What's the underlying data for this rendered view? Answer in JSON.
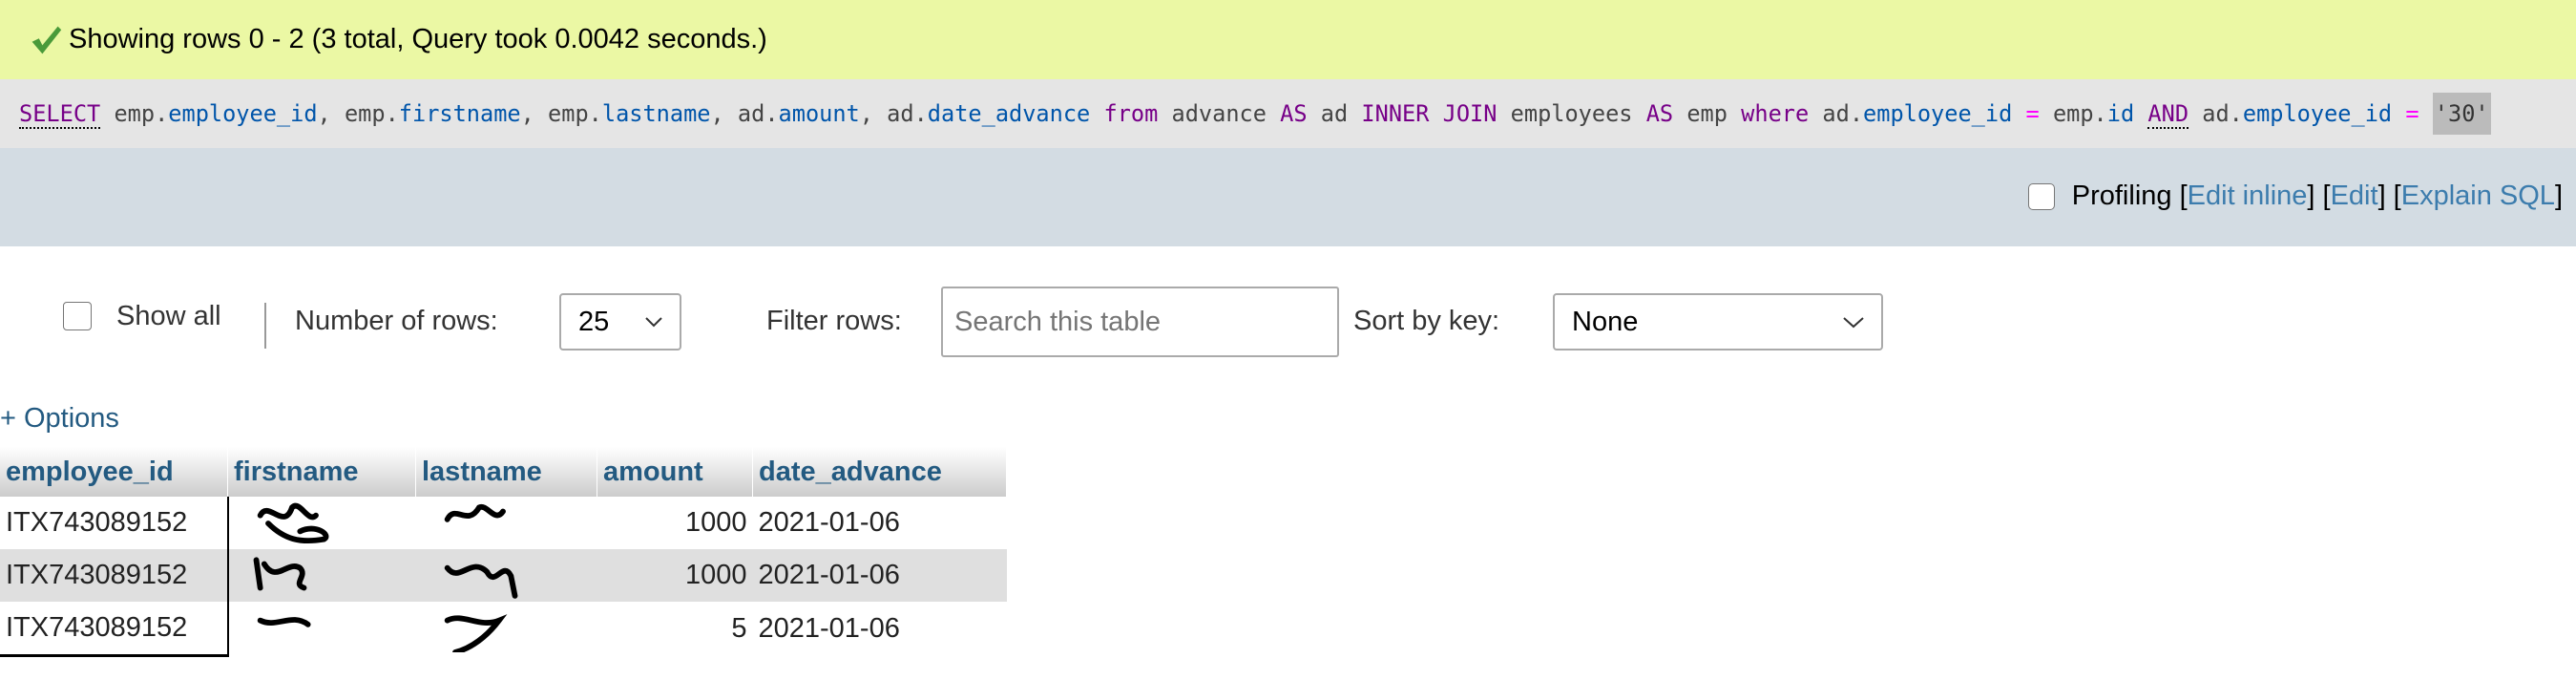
{
  "status": {
    "icon": "check-icon",
    "message": "Showing rows 0 - 2 (3 total, Query took 0.0042 seconds.)",
    "color": "#ebf8a4"
  },
  "sql": {
    "t1": "SELECT",
    " t2": "",
    "e1": "emp.",
    "c1": "employee_id",
    "p1": ", emp.",
    "c2": "firstname",
    "p2": ", emp.",
    "c3": "lastname",
    "p3": ", ad.",
    "c4": "amount",
    "p4": ", ad.",
    "c5": "date_advance",
    "k2": "from",
    "p5": " advance ",
    "k3": "AS",
    "p6": " ad ",
    "k4": "INNER JOIN",
    "p7": " employees ",
    "k5": "AS",
    "p8": " emp ",
    "k6": "where",
    "p9": " ad.",
    "c6": "employee_id",
    "o1": "=",
    "p10": " emp.",
    "c7": "id",
    "k7": "AND",
    "p11": " ad.",
    "c8": "employee_id",
    "o2": "=",
    "s1": "'30'"
  },
  "toolbar": {
    "profiling_label": "Profiling",
    "profiling_checked": false,
    "edit_inline": "Edit inline",
    "edit": "Edit",
    "explain": "Explain SQL"
  },
  "controls": {
    "show_all_label": "Show all",
    "show_all_checked": false,
    "rows_label": "Number of rows:",
    "rows_value": "25",
    "filter_label": "Filter rows:",
    "filter_placeholder": "Search this table",
    "sort_label": "Sort by key:",
    "sort_value": "None"
  },
  "options_link": "+ Options",
  "table": {
    "columns": [
      "employee_id",
      "firstname",
      "lastname",
      "amount",
      "date_advance"
    ],
    "rows": [
      {
        "employee_id": "ITX743089152",
        "firstname": "[redacted]",
        "lastname": "[redacted]",
        "amount": "1000",
        "date_advance": "2021-01-06"
      },
      {
        "employee_id": "ITX743089152",
        "firstname": "[redacted]",
        "lastname": "[redacted]",
        "amount": "1000",
        "date_advance": "2021-01-06"
      },
      {
        "employee_id": "ITX743089152",
        "firstname": "[redacted]",
        "lastname": "[redacted]",
        "amount": "5",
        "date_advance": "2021-01-06"
      }
    ]
  }
}
